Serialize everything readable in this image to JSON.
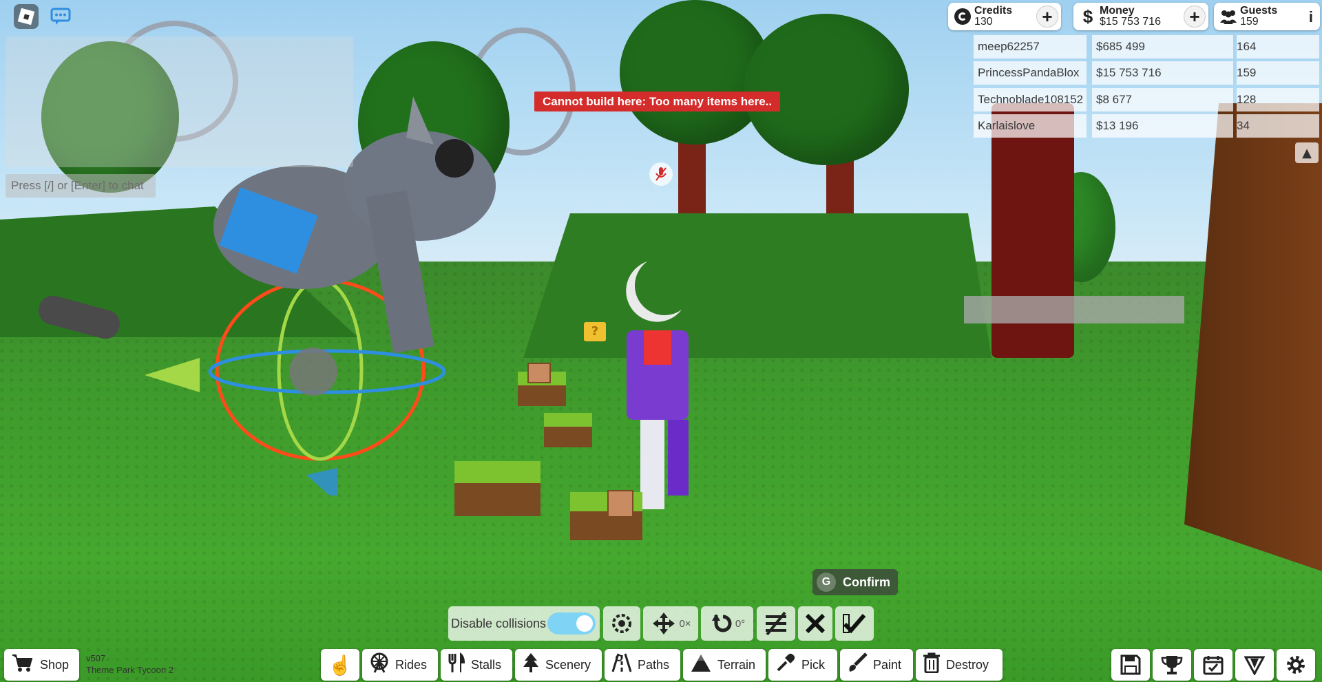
{
  "chat": {
    "input_placeholder": "Press [/] or [Enter] to chat"
  },
  "stats": {
    "credits": {
      "label": "Credits",
      "value": "130"
    },
    "money": {
      "label": "Money",
      "value": "$15 753 716"
    },
    "guests": {
      "label": "Guests",
      "value": "159"
    }
  },
  "leaderboard": [
    {
      "name": "meep62257",
      "money": "$685 499",
      "guests": "164"
    },
    {
      "name": "PrincessPandaBlox",
      "money": "$15 753 716",
      "guests": "159"
    },
    {
      "name": "Technoblade108152",
      "money": "$8 677",
      "guests": "128"
    },
    {
      "name": "Karlaislove",
      "money": "$13 196",
      "guests": "34"
    }
  ],
  "error_message": "Cannot build here: Too many items here..",
  "confirm_tip": {
    "key": "G",
    "label": "Confirm"
  },
  "build_toolbar": {
    "collision_label": "Disable collisions",
    "collision_enabled": true,
    "move_step": "0×",
    "rotate_step": "0°"
  },
  "bottom_bar": {
    "shop": "Shop",
    "version": "v507",
    "game_title": "Theme Park Tycoon 2",
    "categories": [
      "Rides",
      "Stalls",
      "Scenery",
      "Paths",
      "Terrain",
      "Pick",
      "Paint",
      "Destroy"
    ]
  },
  "colors": {
    "error": "#d42b2b",
    "toggle": "#7fd3f5",
    "grass": "#3f9a2c"
  }
}
